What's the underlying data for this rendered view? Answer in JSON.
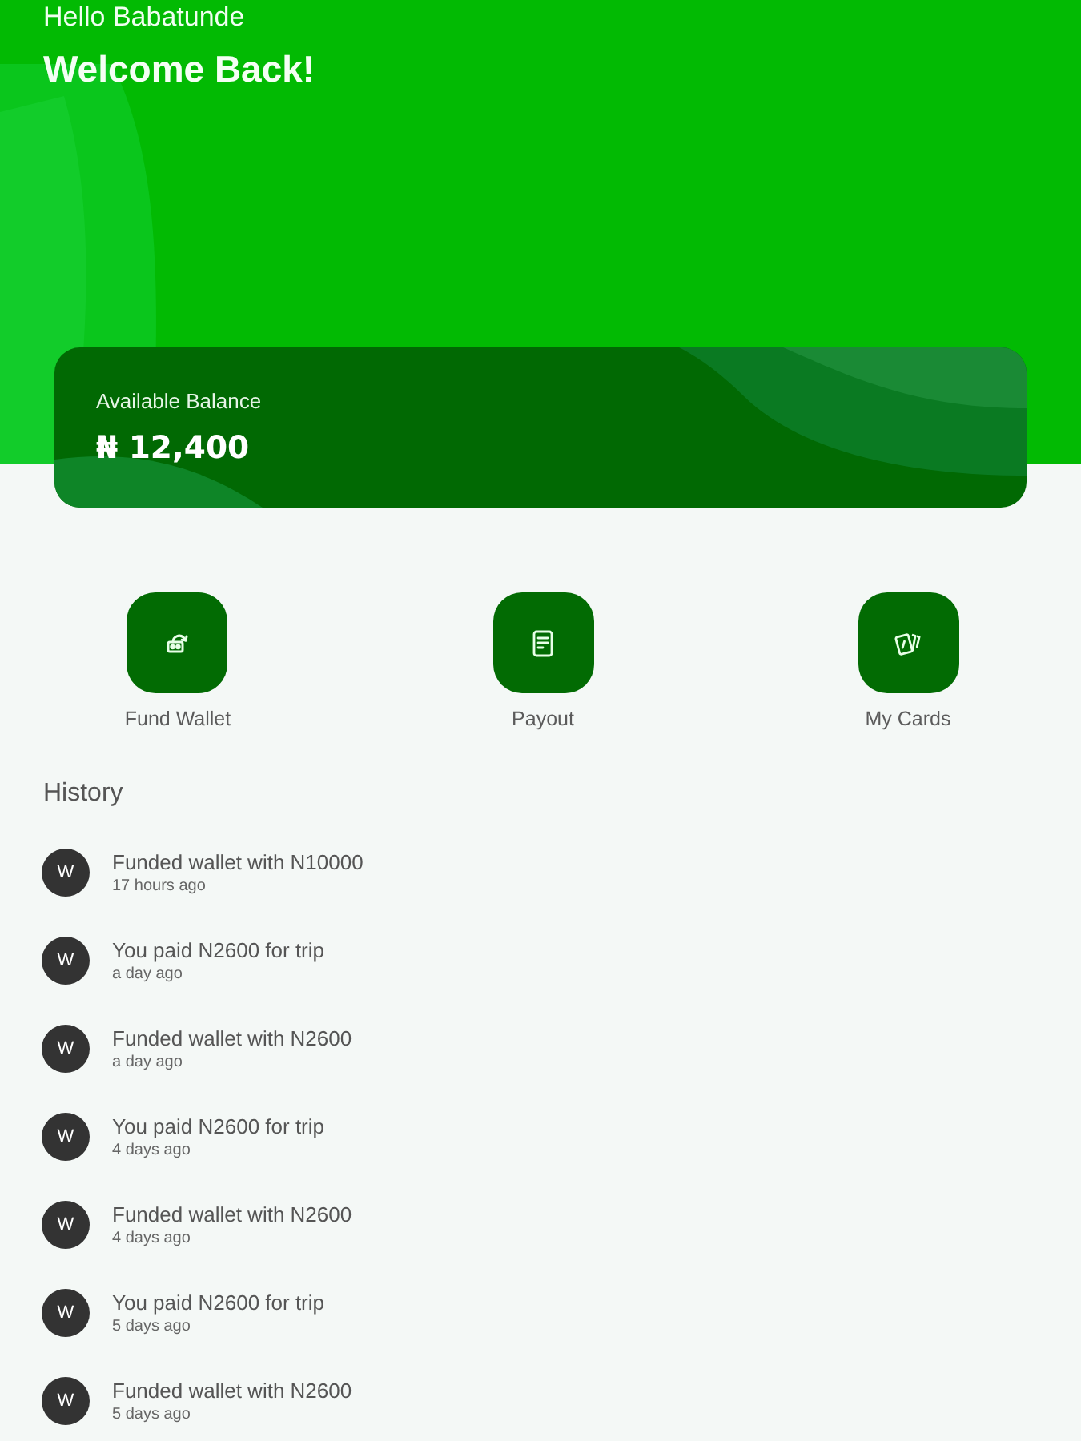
{
  "header": {
    "greeting": "Hello Babatunde",
    "title": "Welcome Back!"
  },
  "balance": {
    "label": "Available Balance",
    "amount": "₦ 12,400"
  },
  "actions": [
    {
      "kind": "fund",
      "label": "Fund Wallet"
    },
    {
      "kind": "payout",
      "label": "Payout"
    },
    {
      "kind": "cards",
      "label": "My Cards"
    }
  ],
  "history": {
    "title": "History",
    "items": [
      {
        "initial": "W",
        "text": "Funded wallet with N10000",
        "time": "17 hours ago"
      },
      {
        "initial": "W",
        "text": "You paid N2600 for trip",
        "time": "a day ago"
      },
      {
        "initial": "W",
        "text": "Funded wallet with N2600",
        "time": "a day ago"
      },
      {
        "initial": "W",
        "text": "You paid N2600 for trip",
        "time": "4 days ago"
      },
      {
        "initial": "W",
        "text": "Funded wallet with N2600",
        "time": "4 days ago"
      },
      {
        "initial": "W",
        "text": "You paid N2600 for trip",
        "time": "5 days ago"
      },
      {
        "initial": "W",
        "text": "Funded wallet with N2600",
        "time": "5 days ago"
      }
    ]
  }
}
